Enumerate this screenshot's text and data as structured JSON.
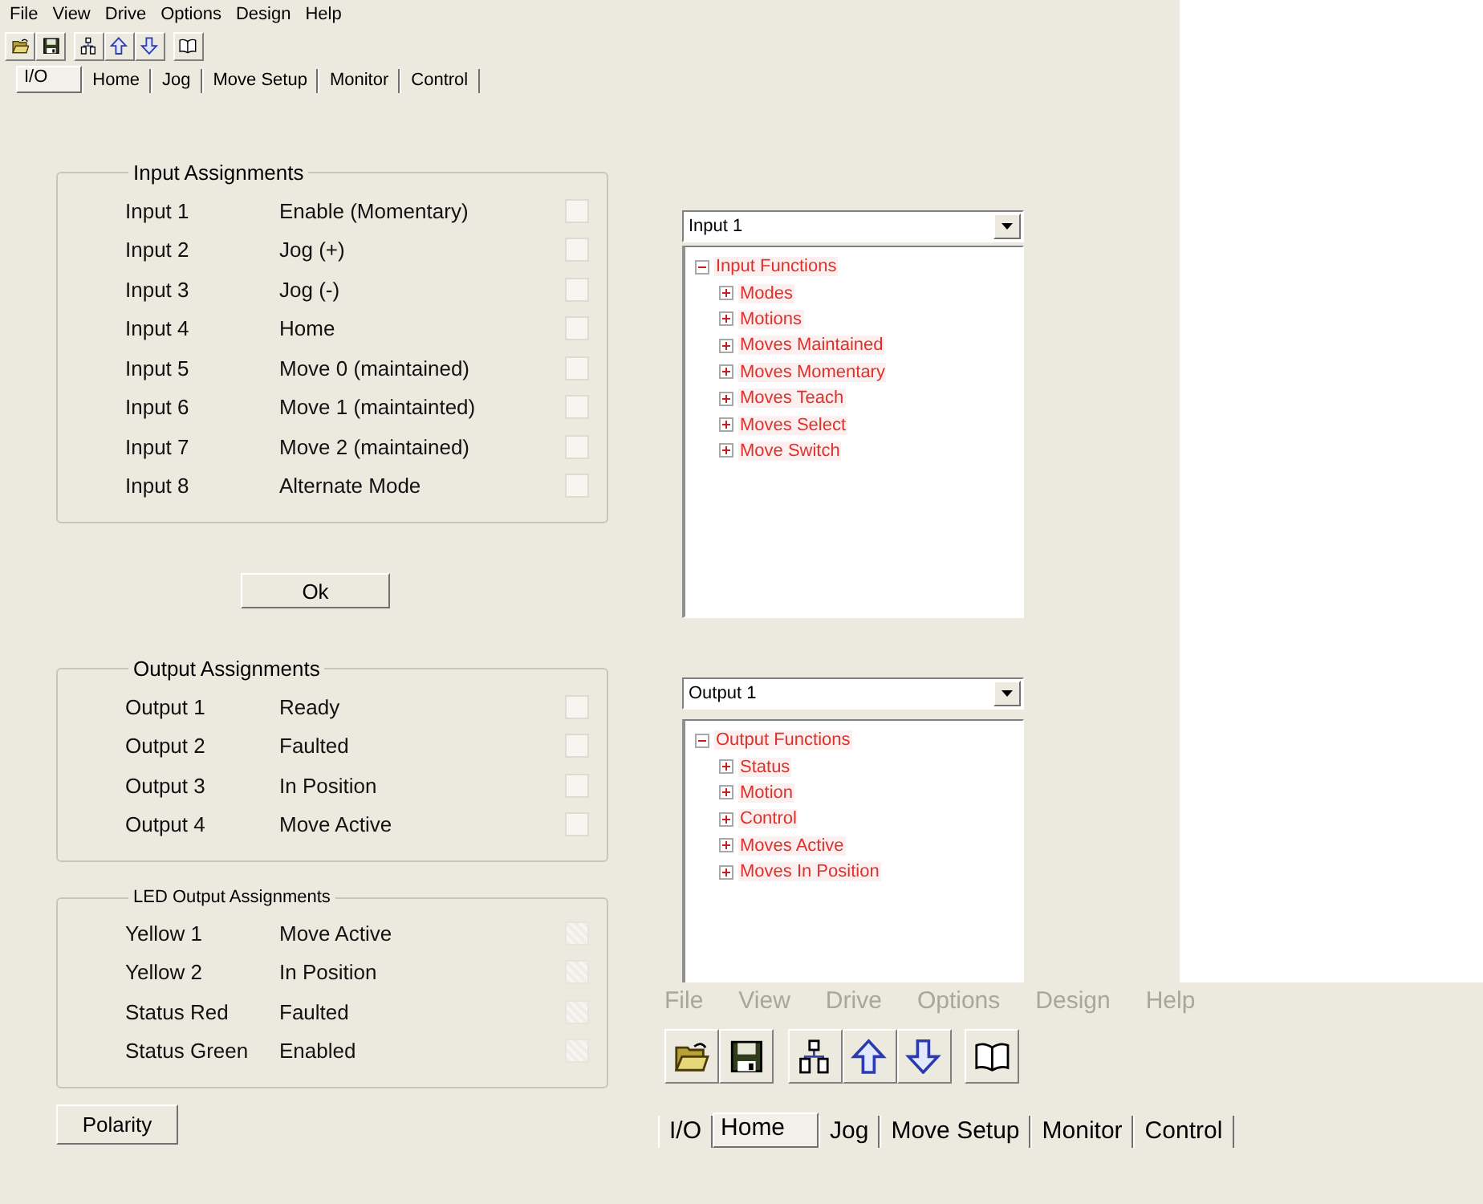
{
  "menu": [
    {
      "label": "File",
      "disabled": false
    },
    {
      "label": "View",
      "disabled": false
    },
    {
      "label": "Drive",
      "disabled": false
    },
    {
      "label": "Options",
      "disabled": false
    },
    {
      "label": "Design",
      "disabled": false
    },
    {
      "label": "Help",
      "disabled": false
    }
  ],
  "toolbar": [
    {
      "kind": "open"
    },
    {
      "kind": "save"
    },
    {
      "kind": "network"
    },
    {
      "kind": "up"
    },
    {
      "kind": "down"
    },
    {
      "kind": "book"
    }
  ],
  "tabs": [
    {
      "label": "I/O",
      "selected": true
    },
    {
      "label": "Home",
      "selected": false
    },
    {
      "label": "Jog",
      "selected": false
    },
    {
      "label": "Move Setup",
      "selected": false
    },
    {
      "label": "Monitor",
      "selected": false
    },
    {
      "label": "Control",
      "selected": false
    }
  ],
  "input_assignments": {
    "title": "Input Assignments",
    "rows": [
      {
        "name": "Input 1",
        "function": "Enable (Momentary)",
        "checked": false,
        "disabled": false
      },
      {
        "name": "Input 2",
        "function": "Jog (+)",
        "checked": false,
        "disabled": false
      },
      {
        "name": "Input 3",
        "function": "Jog (-)",
        "checked": false,
        "disabled": false
      },
      {
        "name": "Input 4",
        "function": "Home",
        "checked": false,
        "disabled": false
      },
      {
        "name": "Input 5",
        "function": "Move 0 (maintained)",
        "checked": false,
        "disabled": false
      },
      {
        "name": "Input 6",
        "function": "Move 1 (maintainted)",
        "checked": false,
        "disabled": false
      },
      {
        "name": "Input 7",
        "function": "Move 2 (maintained)",
        "checked": false,
        "disabled": false
      },
      {
        "name": "Input 8",
        "function": "Alternate Mode",
        "checked": false,
        "disabled": false
      }
    ]
  },
  "ok_button": "Ok",
  "output_assignments": {
    "title": "Output Assignments",
    "rows": [
      {
        "name": "Output 1",
        "function": "Ready",
        "checked": false,
        "disabled": false
      },
      {
        "name": "Output 2",
        "function": "Faulted",
        "checked": false,
        "disabled": false
      },
      {
        "name": "Output 3",
        "function": "In Position",
        "checked": false,
        "disabled": false
      },
      {
        "name": "Output 4",
        "function": "Move Active",
        "checked": false,
        "disabled": false
      }
    ]
  },
  "led_output_assignments": {
    "title": "LED Output Assignments",
    "rows": [
      {
        "name": "Yellow 1",
        "function": "Move Active",
        "checked": false,
        "disabled": true
      },
      {
        "name": "Yellow 2",
        "function": "In Position",
        "checked": false,
        "disabled": true
      },
      {
        "name": "Status Red",
        "function": "Faulted",
        "checked": false,
        "disabled": true
      },
      {
        "name": "Status Green",
        "function": "Enabled",
        "checked": false,
        "disabled": true
      }
    ]
  },
  "polarity_button": "Polarity",
  "input_select": {
    "value": "Input 1"
  },
  "input_tree": {
    "label": "Input Functions",
    "expanded": true,
    "children": [
      {
        "label": "Modes",
        "expanded": false
      },
      {
        "label": "Motions",
        "expanded": false
      },
      {
        "label": "Moves Maintained",
        "expanded": false
      },
      {
        "label": "Moves Momentary",
        "expanded": false
      },
      {
        "label": "Moves Teach",
        "expanded": false
      },
      {
        "label": "Moves Select",
        "expanded": false
      },
      {
        "label": "Move Switch",
        "expanded": false
      }
    ]
  },
  "output_select": {
    "value": "Output 1"
  },
  "output_tree": {
    "label": "Output Functions",
    "expanded": true,
    "children": [
      {
        "label": "Status",
        "expanded": false
      },
      {
        "label": "Motion",
        "expanded": false
      },
      {
        "label": "Control",
        "expanded": false
      },
      {
        "label": "Moves Active",
        "expanded": false
      },
      {
        "label": "Moves In Position",
        "expanded": false
      }
    ]
  },
  "overlay_window": {
    "menu": [
      {
        "label": "File",
        "disabled": true
      },
      {
        "label": "View",
        "disabled": true
      },
      {
        "label": "Drive",
        "disabled": true
      },
      {
        "label": "Options",
        "disabled": true
      },
      {
        "label": "Design",
        "disabled": true
      },
      {
        "label": "Help",
        "disabled": true
      }
    ],
    "toolbar": [
      {
        "kind": "open"
      },
      {
        "kind": "save"
      },
      {
        "kind": "network"
      },
      {
        "kind": "up"
      },
      {
        "kind": "down"
      },
      {
        "kind": "book"
      }
    ],
    "tabs": [
      {
        "label": "I/O",
        "selected": false
      },
      {
        "label": "Home",
        "selected": true
      },
      {
        "label": "Jog",
        "selected": false
      },
      {
        "label": "Move Setup",
        "selected": false
      },
      {
        "label": "Monitor",
        "selected": false
      },
      {
        "label": "Control",
        "selected": false
      }
    ]
  }
}
